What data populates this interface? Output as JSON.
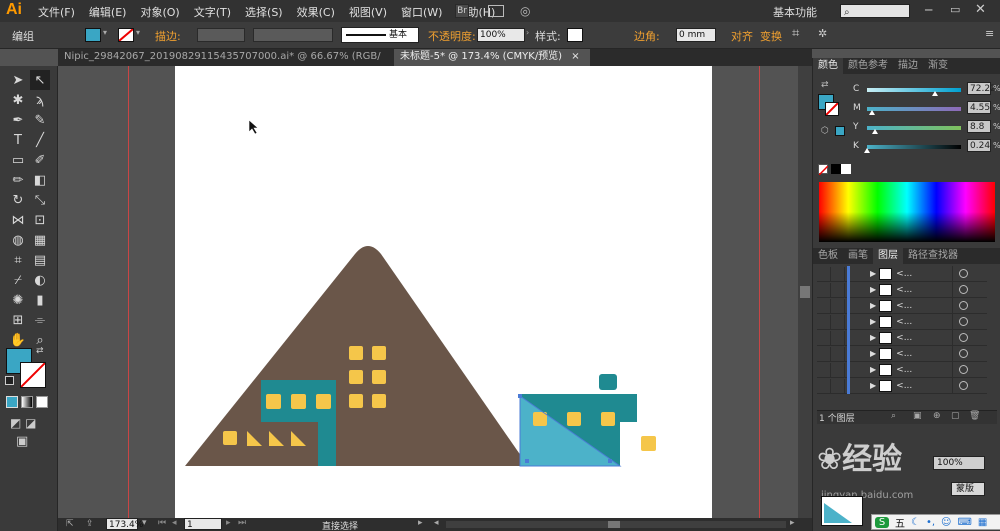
{
  "app": {
    "logo": "Ai"
  },
  "menu": [
    "文件(F)",
    "编辑(E)",
    "对象(O)",
    "文字(T)",
    "选择(S)",
    "效果(C)",
    "视图(V)",
    "窗口(W)",
    "帮助(H)"
  ],
  "menubar_right": {
    "br_label": "Br",
    "workspace": "基本功能",
    "search_placeholder": ""
  },
  "control_bar": {
    "selection_label": "编组",
    "stroke_label": "描边:",
    "brush_label": "基本",
    "opacity_label": "不透明度:",
    "opacity_value": "100%",
    "style_label": "样式:",
    "corner_label": "边角:",
    "corner_value": "0 mm",
    "align_label": "对齐",
    "transform_label": "变换"
  },
  "tabs": [
    {
      "label": "Nipic_29842067_20190829115435707000.ai* @ 66.67% (RGB/预览)",
      "close": "×"
    },
    {
      "label": "未标题-5* @ 173.4% (CMYK/预览)",
      "close": "×"
    }
  ],
  "color_panel": {
    "tabs": [
      "颜色",
      "颜色参考",
      "描边",
      "渐变"
    ],
    "channels": [
      {
        "label": "C",
        "value": "72.22",
        "pct": 0.72,
        "unit": "%"
      },
      {
        "label": "M",
        "value": "4.55",
        "pct": 0.05,
        "unit": "%"
      },
      {
        "label": "Y",
        "value": "8.8",
        "pct": 0.09,
        "unit": "%"
      },
      {
        "label": "K",
        "value": "0.24",
        "pct": 0.0,
        "unit": "%"
      }
    ],
    "fill_color": "#3aa6c4"
  },
  "layers_panel": {
    "tabs": [
      "色板",
      "画笔",
      "图层",
      "路径查找器"
    ],
    "row_label": "<...",
    "rows": 8,
    "footer": "1 个图层"
  },
  "status_bar": {
    "zoom": "173.4%",
    "page": "1",
    "tool": "直接选择"
  },
  "overlay_panel": {
    "label": "蒙版"
  },
  "watermark": {
    "text": "经验",
    "sub": "jingyan.baidu.com"
  },
  "ime": {
    "label": "五"
  },
  "colors": {
    "mountain": "#6a5649",
    "teal": "#1f8a91",
    "teal_light": "#4cb2c9",
    "window": "#f5c64a"
  }
}
